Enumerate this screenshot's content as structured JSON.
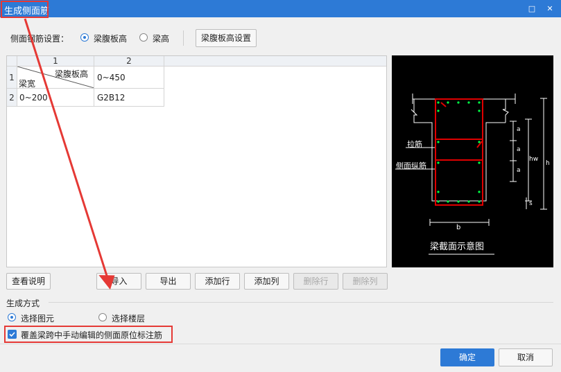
{
  "window": {
    "title": "生成侧面筋",
    "restore_icon": "□",
    "close_icon": "✕"
  },
  "side_setting": {
    "label": "侧面钢筋设置：",
    "option1": "梁腹板高",
    "option2": "梁高",
    "config_button": "梁腹板高设置"
  },
  "table": {
    "col_headers": [
      "1",
      "2"
    ],
    "row_headers": [
      "1",
      "2"
    ],
    "corner_top": "梁腹板高",
    "corner_bottom": "梁宽",
    "r1c2": "0~450",
    "r2c1": "0~200",
    "r2c2": "G2B12"
  },
  "diagram": {
    "title": "梁截面示意图",
    "label_tie": "拉筋",
    "label_long": "侧面纵筋",
    "dim_a": "a",
    "dim_hw": "hw",
    "dim_h": "h",
    "dim_s": "s",
    "dim_b": "b"
  },
  "buttons": {
    "view_help": "查看说明",
    "import": "导入",
    "export": "导出",
    "add_row": "添加行",
    "add_col": "添加列",
    "del_row": "删除行",
    "del_col": "删除列",
    "ok": "确定",
    "cancel": "取消"
  },
  "gen_mode": {
    "title": "生成方式",
    "option1": "选择图元",
    "option2": "选择楼层"
  },
  "overwrite": {
    "label": "覆盖梁跨中手动编辑的侧面原位标注筋"
  },
  "colors": {
    "accent": "#2d7ad6",
    "highlight": "#e53935",
    "rebar": "#e00000",
    "dot": "#00ff44"
  }
}
